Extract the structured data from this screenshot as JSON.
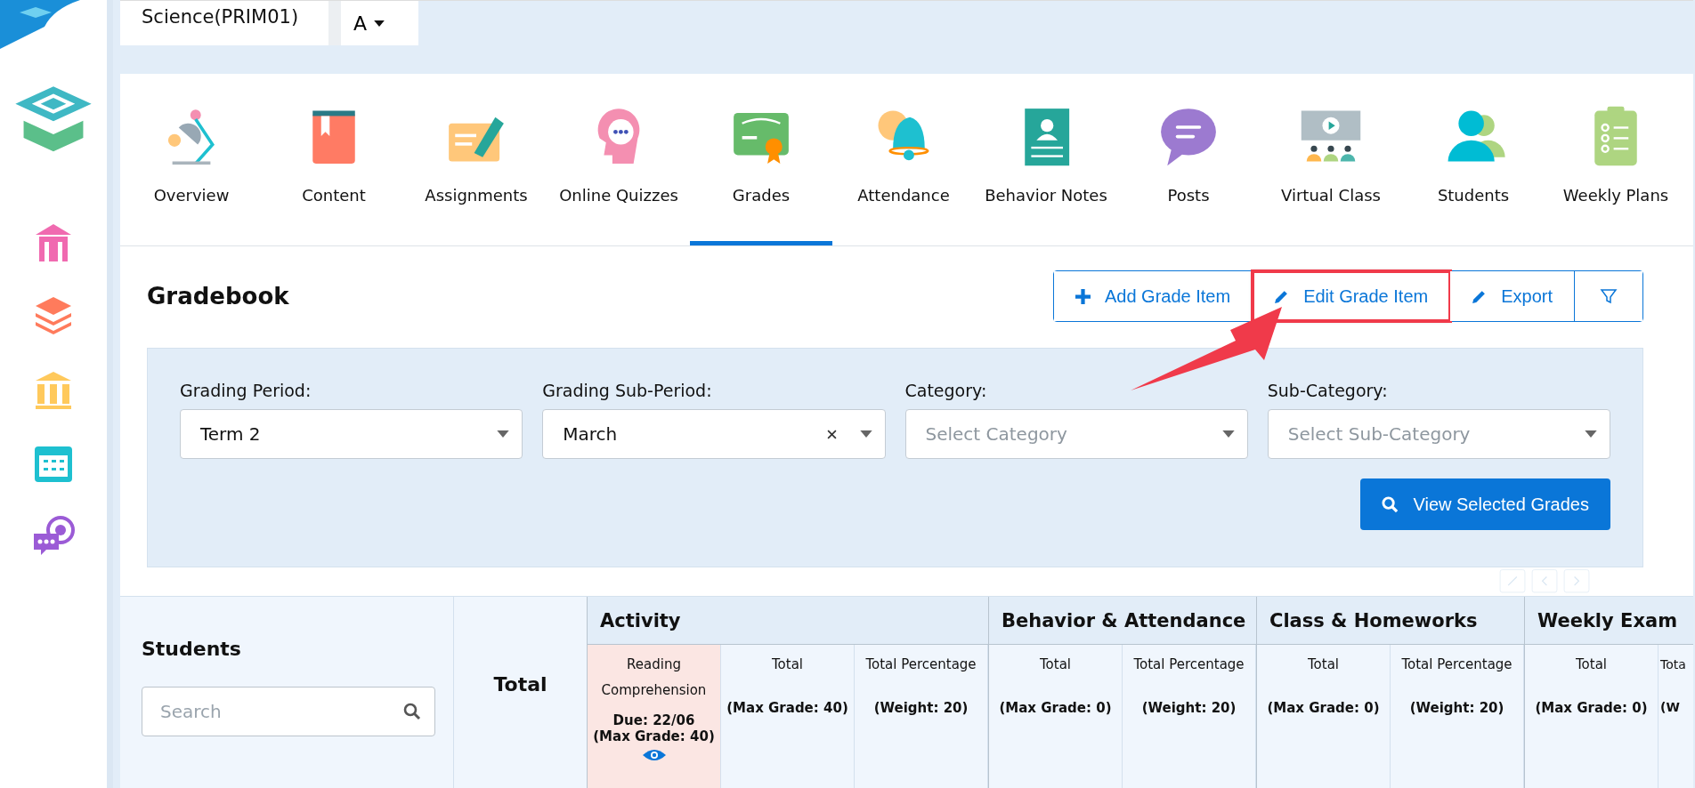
{
  "course": {
    "name": "Science(PRIM01)",
    "section": "A"
  },
  "tabs": [
    {
      "kind": "overview",
      "label": "Overview",
      "selected": false
    },
    {
      "kind": "content",
      "label": "Content",
      "selected": false
    },
    {
      "kind": "assignments",
      "label": "Assignments",
      "selected": false
    },
    {
      "kind": "quizzes",
      "label": "Online Quizzes",
      "selected": false
    },
    {
      "kind": "grades",
      "label": "Grades",
      "selected": true
    },
    {
      "kind": "attendance",
      "label": "Attendance",
      "selected": false
    },
    {
      "kind": "behavior",
      "label": "Behavior Notes",
      "selected": false
    },
    {
      "kind": "posts",
      "label": "Posts",
      "selected": false
    },
    {
      "kind": "virtual",
      "label": "Virtual Class",
      "selected": false
    },
    {
      "kind": "students",
      "label": "Students",
      "selected": false
    },
    {
      "kind": "plans",
      "label": "Weekly Plans",
      "selected": false
    }
  ],
  "gradebook": {
    "title": "Gradebook",
    "actions": [
      {
        "kind": "add",
        "label": "Add Grade Item",
        "highlighted": false
      },
      {
        "kind": "edit",
        "label": "Edit Grade Item",
        "highlighted": true
      },
      {
        "kind": "export",
        "label": "Export",
        "highlighted": false
      },
      {
        "kind": "filter",
        "highlighted": false
      }
    ]
  },
  "filters": [
    {
      "label": "Grading Period:",
      "value": "Term 2",
      "clearable": false
    },
    {
      "label": "Grading Sub-Period:",
      "value": "March",
      "clearable": true
    },
    {
      "label": "Category:",
      "placeholder": "Select Category",
      "clearable": false
    },
    {
      "label": "Sub-Category:",
      "placeholder": "Select Sub-Category",
      "clearable": false
    }
  ],
  "view_button": "View Selected Grades",
  "table": {
    "students_header": "Students",
    "search_placeholder": "Search",
    "total_header": "Total",
    "groups": [
      {
        "title": "Activity",
        "columns": [
          {
            "kind": "item",
            "title": "Reading Comprehension",
            "due": "Due: 22/06",
            "detail": "(Max Grade: 40)"
          },
          {
            "kind": "total",
            "title": "Total",
            "detail": "(Max Grade: 40)"
          },
          {
            "kind": "total",
            "title": "Total Percentage",
            "detail": "(Weight: 20)"
          }
        ]
      },
      {
        "title": "Behavior & Attendance",
        "columns": [
          {
            "kind": "total",
            "title": "Total",
            "detail": "(Max Grade: 0)"
          },
          {
            "kind": "total",
            "title": "Total Percentage",
            "detail": "(Weight: 20)"
          }
        ]
      },
      {
        "title": "Class & Homeworks",
        "columns": [
          {
            "kind": "total",
            "title": "Total",
            "detail": "(Max Grade: 0)"
          },
          {
            "kind": "total",
            "title": "Total Percentage",
            "detail": "(Weight: 20)"
          }
        ]
      },
      {
        "title": "Weekly Exam",
        "columns": [
          {
            "kind": "total",
            "title": "Total",
            "detail": "(Max Grade: 0)"
          },
          {
            "kind": "partial",
            "title": "Tota",
            "detail": "(W"
          }
        ]
      }
    ]
  }
}
